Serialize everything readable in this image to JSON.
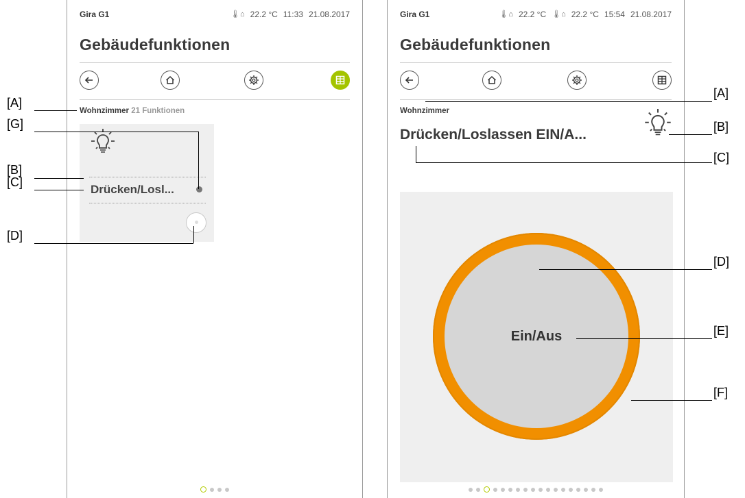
{
  "left_screen": {
    "device": "Gira G1",
    "status": {
      "temperature": "22.2 °C",
      "time": "11:33",
      "date": "21.08.2017"
    },
    "title": "Gebäudefunktionen",
    "nav": {
      "back_icon": "arrow-left-icon",
      "home_icon": "home-icon",
      "settings_icon": "gear-icon",
      "grid_icon": "grid-icon",
      "active": "grid"
    },
    "breadcrumb": {
      "room": "Wohnzimmer",
      "count": "21",
      "suffix": "Funktionen"
    },
    "tile": {
      "icon": "lightbulb-icon",
      "name": "Drücken/Losl..."
    },
    "pager": {
      "count": 4,
      "active_index": 0
    }
  },
  "right_screen": {
    "device": "Gira G1",
    "status": {
      "temperature_1": "22.2 °C",
      "temperature_2": "22.2 °C",
      "time": "15:54",
      "date": "21.08.2017"
    },
    "title": "Gebäudefunktionen",
    "nav": {
      "back_icon": "arrow-left-icon",
      "home_icon": "home-icon",
      "settings_icon": "gear-icon",
      "grid_icon": "grid-icon"
    },
    "room": "Wohnzimmer",
    "function_name": "Drücken/Loslassen EIN/A...",
    "button_label": "Ein/Aus",
    "pager": {
      "count": 18,
      "active_index": 2
    }
  },
  "callouts": {
    "left": {
      "A": "[A]",
      "G": "[G]",
      "B": "[B]",
      "C": "[C]",
      "D": "[D]"
    },
    "right": {
      "A": "[A]",
      "B": "[B]",
      "C": "[C]",
      "D": "[D]",
      "E": "[E]",
      "F": "[F]"
    }
  },
  "colors": {
    "accent_green": "#a4c400",
    "ring_orange": "#f18f00",
    "panel_gray": "#efefef"
  }
}
